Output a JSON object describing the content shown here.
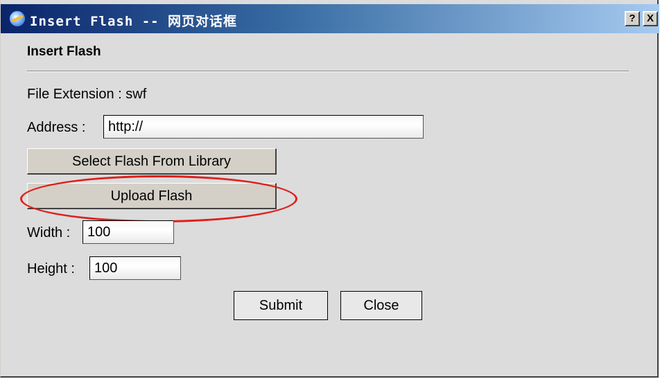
{
  "window": {
    "title": "Insert Flash -- 网页对话框",
    "help_label": "?",
    "close_label": "X"
  },
  "dialog": {
    "heading": "Insert Flash",
    "file_extension_text": "File Extension : swf",
    "address_label": "Address :",
    "address_value": "http://",
    "select_library_label": "Select Flash From Library",
    "upload_label": "Upload Flash",
    "width_label": "Width :",
    "width_value": "100",
    "height_label": "Height :",
    "height_value": "100",
    "submit_label": "Submit",
    "close_label": "Close"
  },
  "colors": {
    "dialog_background": "#dcdcdc",
    "titlebar_start": "#0a246a",
    "titlebar_end": "#a6caf0",
    "highlight": "#e0201c"
  }
}
